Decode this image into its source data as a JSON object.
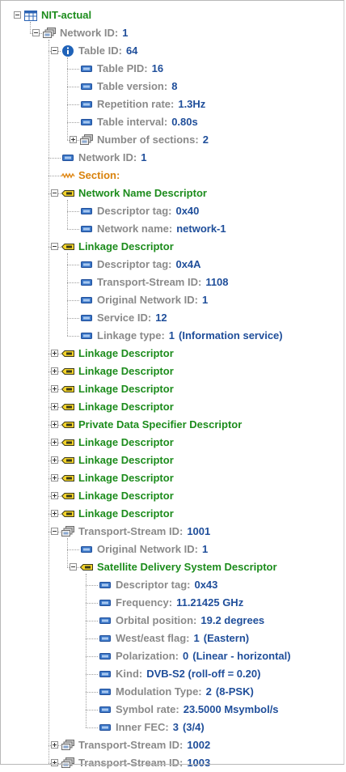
{
  "tree": {
    "nodes": [
      {
        "depth": 0,
        "toggle": "minus",
        "icon": "table-icon",
        "label": "NIT-actual",
        "cls": "c-green"
      },
      {
        "depth": 1,
        "toggle": "minus",
        "icon": "group-icon",
        "key": "Network ID:",
        "value": "1",
        "kcls": "c-gray"
      },
      {
        "depth": 2,
        "toggle": "minus",
        "icon": "info-icon",
        "key": "Table ID:",
        "value": "64",
        "kcls": "c-gray"
      },
      {
        "depth": 3,
        "toggle": "",
        "icon": "field-icon",
        "key": "Table PID:",
        "value": "16",
        "kcls": "c-gray"
      },
      {
        "depth": 3,
        "toggle": "",
        "icon": "field-icon",
        "key": "Table version:",
        "value": "8",
        "kcls": "c-gray"
      },
      {
        "depth": 3,
        "toggle": "",
        "icon": "field-icon",
        "key": "Repetition rate:",
        "value": "1.3Hz",
        "kcls": "c-gray"
      },
      {
        "depth": 3,
        "toggle": "",
        "icon": "field-icon",
        "key": "Table interval:",
        "value": "0.80s",
        "kcls": "c-gray"
      },
      {
        "depth": 3,
        "toggle": "plus",
        "icon": "group-icon",
        "key": "Number of sections:",
        "value": "2",
        "kcls": "c-gray"
      },
      {
        "depth": 2,
        "toggle": "",
        "icon": "field-icon",
        "key": "Network ID:",
        "value": "1",
        "kcls": "c-gray"
      },
      {
        "depth": 2,
        "toggle": "",
        "icon": "wave-icon",
        "label": "Section:",
        "cls": "c-orange"
      },
      {
        "depth": 2,
        "toggle": "minus",
        "icon": "descriptor-icon",
        "label": "Network Name Descriptor",
        "cls": "c-green"
      },
      {
        "depth": 3,
        "toggle": "",
        "icon": "field-icon",
        "key": "Descriptor tag:",
        "value": "0x40",
        "kcls": "c-gray"
      },
      {
        "depth": 3,
        "toggle": "",
        "icon": "field-icon",
        "key": "Network name:",
        "value": "network-1",
        "kcls": "c-gray"
      },
      {
        "depth": 2,
        "toggle": "minus",
        "icon": "descriptor-icon",
        "label": "Linkage Descriptor",
        "cls": "c-green"
      },
      {
        "depth": 3,
        "toggle": "",
        "icon": "field-icon",
        "key": "Descriptor tag:",
        "value": "0x4A",
        "kcls": "c-gray"
      },
      {
        "depth": 3,
        "toggle": "",
        "icon": "field-icon",
        "key": "Transport-Stream ID:",
        "value": "1108",
        "kcls": "c-gray"
      },
      {
        "depth": 3,
        "toggle": "",
        "icon": "field-icon",
        "key": "Original Network ID:",
        "value": "1",
        "kcls": "c-gray"
      },
      {
        "depth": 3,
        "toggle": "",
        "icon": "field-icon",
        "key": "Service ID:",
        "value": "12",
        "kcls": "c-gray"
      },
      {
        "depth": 3,
        "toggle": "",
        "icon": "field-icon",
        "key": "Linkage type:",
        "value": "1",
        "extra": "(Information service)",
        "kcls": "c-gray"
      },
      {
        "depth": 2,
        "toggle": "plus",
        "icon": "descriptor-icon",
        "label": "Linkage Descriptor",
        "cls": "c-green"
      },
      {
        "depth": 2,
        "toggle": "plus",
        "icon": "descriptor-icon",
        "label": "Linkage Descriptor",
        "cls": "c-green"
      },
      {
        "depth": 2,
        "toggle": "plus",
        "icon": "descriptor-icon",
        "label": "Linkage Descriptor",
        "cls": "c-green"
      },
      {
        "depth": 2,
        "toggle": "plus",
        "icon": "descriptor-icon",
        "label": "Linkage Descriptor",
        "cls": "c-green"
      },
      {
        "depth": 2,
        "toggle": "plus",
        "icon": "descriptor-icon",
        "label": "Private Data Specifier Descriptor",
        "cls": "c-green"
      },
      {
        "depth": 2,
        "toggle": "plus",
        "icon": "descriptor-icon",
        "label": "Linkage Descriptor",
        "cls": "c-green"
      },
      {
        "depth": 2,
        "toggle": "plus",
        "icon": "descriptor-icon",
        "label": "Linkage Descriptor",
        "cls": "c-green"
      },
      {
        "depth": 2,
        "toggle": "plus",
        "icon": "descriptor-icon",
        "label": "Linkage Descriptor",
        "cls": "c-green"
      },
      {
        "depth": 2,
        "toggle": "plus",
        "icon": "descriptor-icon",
        "label": "Linkage Descriptor",
        "cls": "c-green"
      },
      {
        "depth": 2,
        "toggle": "plus",
        "icon": "descriptor-icon",
        "label": "Linkage Descriptor",
        "cls": "c-green"
      },
      {
        "depth": 2,
        "toggle": "minus",
        "icon": "group-icon",
        "key": "Transport-Stream ID:",
        "value": "1001",
        "kcls": "c-gray"
      },
      {
        "depth": 3,
        "toggle": "",
        "icon": "field-icon",
        "key": "Original Network ID:",
        "value": "1",
        "kcls": "c-gray"
      },
      {
        "depth": 3,
        "toggle": "minus",
        "icon": "descriptor-icon",
        "label": "Satellite Delivery System Descriptor",
        "cls": "c-green"
      },
      {
        "depth": 4,
        "toggle": "",
        "icon": "field-icon",
        "key": "Descriptor tag:",
        "value": "0x43",
        "kcls": "c-gray"
      },
      {
        "depth": 4,
        "toggle": "",
        "icon": "field-icon",
        "key": "Frequency:",
        "value": "11.21425 GHz",
        "kcls": "c-gray"
      },
      {
        "depth": 4,
        "toggle": "",
        "icon": "field-icon",
        "key": "Orbital position:",
        "value": "19.2 degrees",
        "kcls": "c-gray"
      },
      {
        "depth": 4,
        "toggle": "",
        "icon": "field-icon",
        "key": "West/east flag:",
        "value": "1",
        "extra": "(Eastern)",
        "kcls": "c-gray"
      },
      {
        "depth": 4,
        "toggle": "",
        "icon": "field-icon",
        "key": "Polarization:",
        "value": "0",
        "extra": "(Linear - horizontal)",
        "kcls": "c-gray"
      },
      {
        "depth": 4,
        "toggle": "",
        "icon": "field-icon",
        "key": "Kind:",
        "value": "DVB-S2 (roll-off = 0.20)",
        "kcls": "c-gray"
      },
      {
        "depth": 4,
        "toggle": "",
        "icon": "field-icon",
        "key": "Modulation Type:",
        "value": "2",
        "extra": "(8-PSK)",
        "kcls": "c-gray"
      },
      {
        "depth": 4,
        "toggle": "",
        "icon": "field-icon",
        "key": "Symbol rate:",
        "value": "23.5000 Msymbol/s",
        "kcls": "c-gray"
      },
      {
        "depth": 4,
        "toggle": "",
        "icon": "field-icon",
        "key": "Inner FEC:",
        "value": "3",
        "extra": "(3/4)",
        "kcls": "c-gray"
      },
      {
        "depth": 2,
        "toggle": "plus",
        "icon": "group-icon",
        "key": "Transport-Stream ID:",
        "value": "1002",
        "kcls": "c-gray"
      },
      {
        "depth": 2,
        "toggle": "plus",
        "icon": "group-icon",
        "key": "Transport-Stream ID:",
        "value": "1003",
        "kcls": "c-gray"
      }
    ]
  }
}
